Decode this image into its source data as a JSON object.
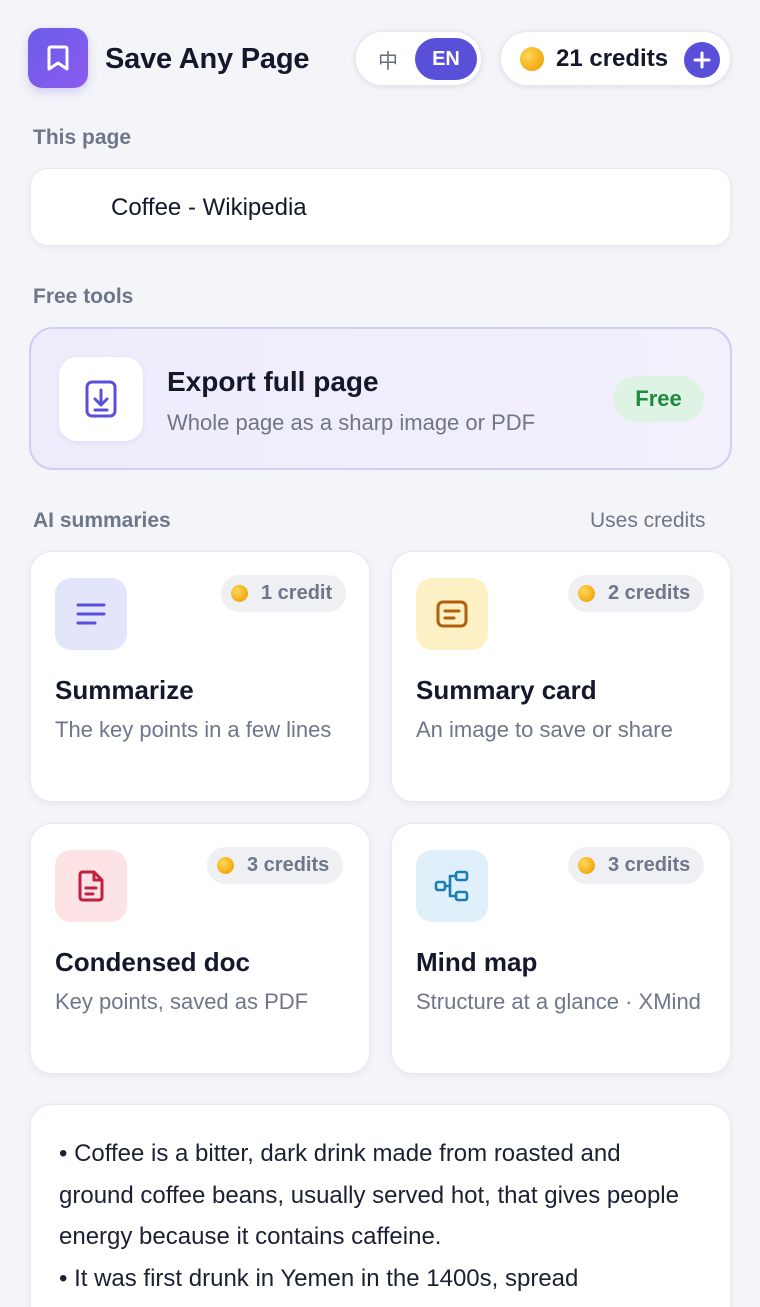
{
  "header": {
    "app_name": "Save Any Page",
    "logo_icon": "bookmark-icon",
    "lang_zh": "中",
    "lang_en": "EN",
    "active_lang": "EN",
    "credits_label": "21 credits",
    "add_credits_icon": "plus-icon",
    "accent_color": "#5a4fd8"
  },
  "this_page": {
    "label": "This page",
    "title": "Coffee - Wikipedia"
  },
  "free_tools": {
    "label": "Free tools",
    "export": {
      "icon": "download-icon",
      "title": "Export full page",
      "description": "Whole page as a sharp image or PDF",
      "badge": "Free"
    }
  },
  "ai_summaries": {
    "label": "AI summaries",
    "note": "Uses credits",
    "tools": [
      {
        "icon": "text-lines-icon",
        "cost": "1 credit",
        "title": "Summarize",
        "description": "The key points in a few lines"
      },
      {
        "icon": "card-icon",
        "cost": "2 credits",
        "title": "Summary card",
        "description": "An image to save or share"
      },
      {
        "icon": "document-icon",
        "cost": "3 credits",
        "title": "Condensed doc",
        "description": "Key points, saved as PDF"
      },
      {
        "icon": "mind-map-icon",
        "cost": "3 credits",
        "title": "Mind map",
        "description": "Structure at a glance · XMind"
      }
    ]
  },
  "summary_result": {
    "bullets": [
      "• Coffee is a bitter, dark drink made from roasted and ground coffee beans, usually served hot, that gives people energy because it contains caffeine.",
      "• It was first drunk in Yemen in the 1400s, spread"
    ]
  }
}
